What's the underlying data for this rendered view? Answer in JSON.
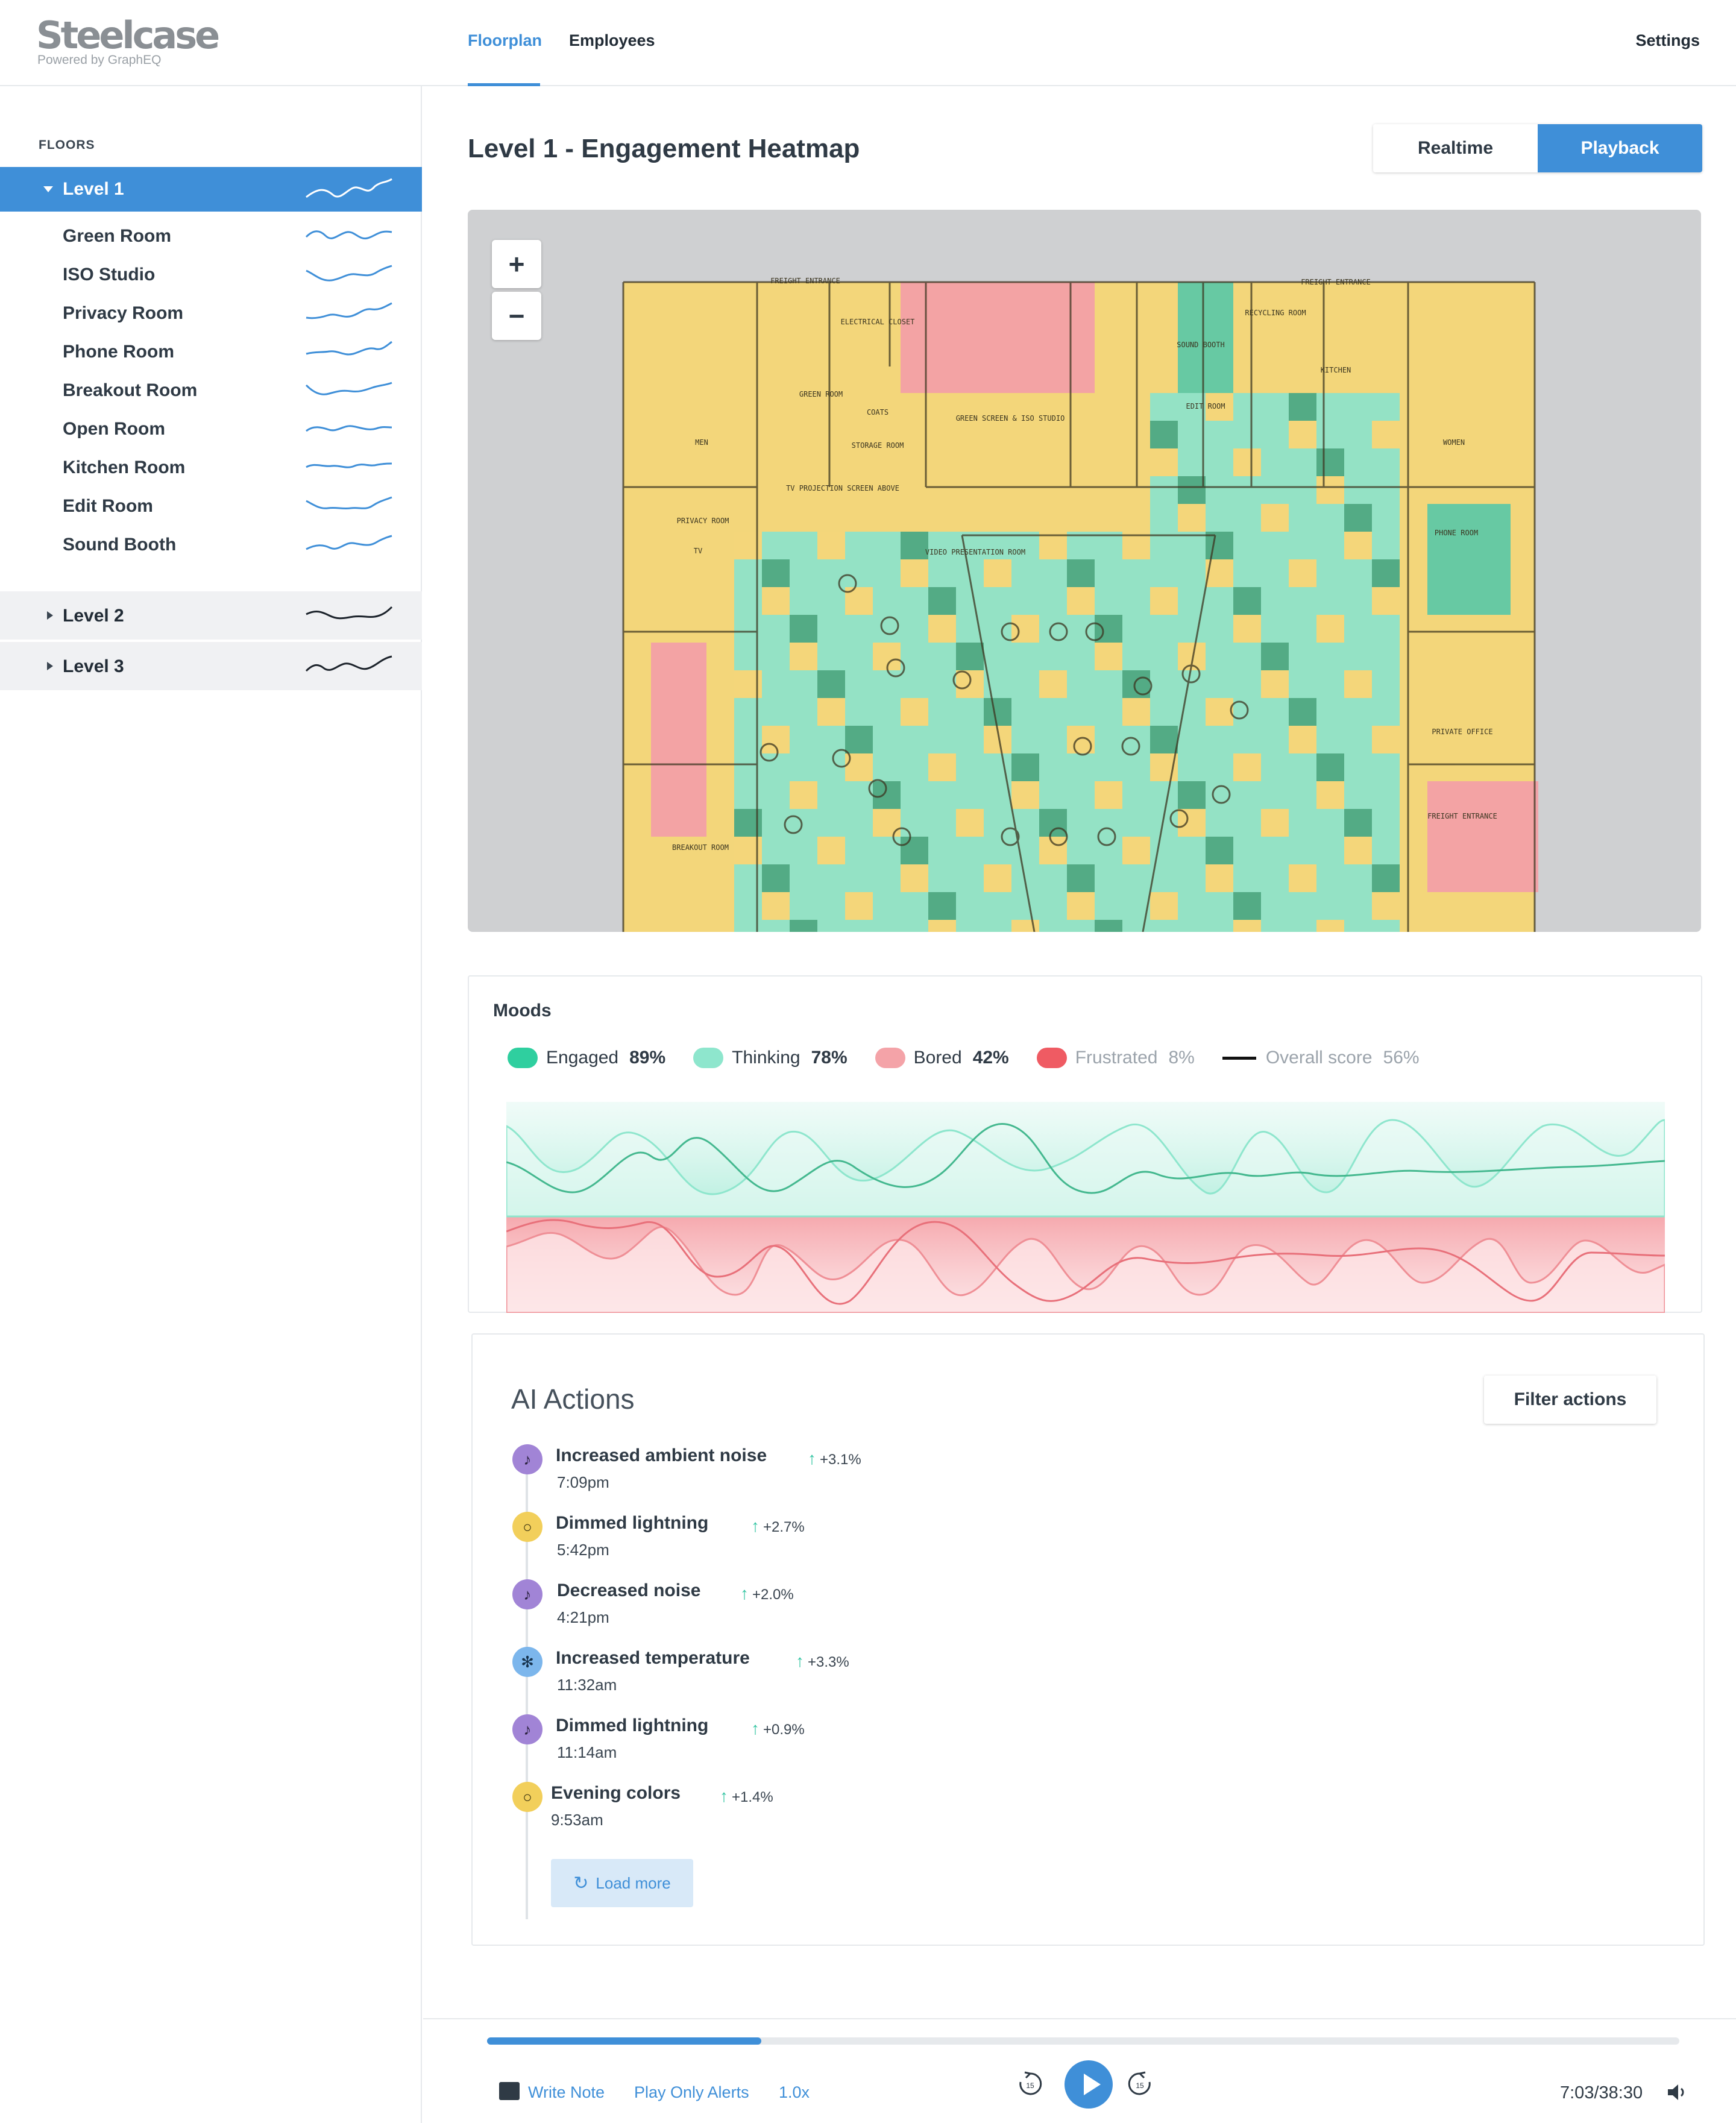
{
  "brand": {
    "name": "Steelcase",
    "sub": "Powered by GraphEQ"
  },
  "nav": {
    "tabs": [
      "Floorplan",
      "Employees"
    ],
    "active": "Floorplan",
    "settings": "Settings"
  },
  "sidebar": {
    "title": "FLOORS",
    "levels": [
      {
        "label": "Level 1",
        "expanded": true,
        "rooms": [
          "Green Room",
          "ISO Studio",
          "Privacy Room",
          "Phone Room",
          "Breakout Room",
          "Open Room",
          "Kitchen Room",
          "Edit Room",
          "Sound Booth"
        ]
      },
      {
        "label": "Level 2",
        "expanded": false
      },
      {
        "label": "Level 3",
        "expanded": false
      }
    ]
  },
  "main": {
    "title": "Level 1 - Engagement Heatmap",
    "mode": {
      "options": [
        "Realtime",
        "Playback"
      ],
      "selected": "Playback"
    },
    "zoom": {
      "in": "+",
      "out": "−"
    }
  },
  "floorplan_labels": [
    "FREIGHT ENTRANCE",
    "ELECTRICAL CLOSET",
    "GREEN ROOM",
    "COATS",
    "STORAGE ROOM",
    "GREEN SCREEN & ISO STUDIO",
    "SOUND BOOTH",
    "RECYCLING ROOM",
    "EDIT ROOM",
    "KITCHEN",
    "MEN",
    "WOMEN",
    "PRIVACY ROOM",
    "PHONE ROOM",
    "TV",
    "TV PROJECTION SCREEN ABOVE",
    "VIDEO PRESENTATION ROOM",
    "BREAKOUT ROOM",
    "PRIVATE OFFICE",
    "FREIGHT ENTRANCE"
  ],
  "moods": {
    "title": "Moods",
    "legend": [
      {
        "name": "Engaged",
        "value": "89%",
        "color": "#2fcf9f",
        "dim": false
      },
      {
        "name": "Thinking",
        "value": "78%",
        "color": "#8ee6cd",
        "dim": false
      },
      {
        "name": "Bored",
        "value": "42%",
        "color": "#f4a3a8",
        "dim": false
      },
      {
        "name": "Frustrated",
        "value": "8%",
        "color": "#ef5b63",
        "dim": true
      },
      {
        "name": "Overall score",
        "value": "56%",
        "color": "#111111",
        "dim": true
      }
    ]
  },
  "ai_actions": {
    "title": "AI Actions",
    "filter_label": "Filter actions",
    "items": [
      {
        "title": "Increased ambient noise",
        "delta": "+3.1%",
        "time": "7:09pm",
        "icon": "music-note-icon"
      },
      {
        "title": "Dimmed lightning",
        "delta": "+2.7%",
        "time": "5:42pm",
        "icon": "lightbulb-icon"
      },
      {
        "title": "Decreased noise",
        "delta": "+2.0%",
        "time": "4:21pm",
        "icon": "music-note-icon"
      },
      {
        "title": "Increased temperature",
        "delta": "+3.3%",
        "time": "11:32am",
        "icon": "snowflake-icon"
      },
      {
        "title": "Dimmed lightning",
        "delta": "+0.9%",
        "time": "11:14am",
        "icon": "music-note-icon"
      },
      {
        "title": "Evening colors",
        "delta": "+1.4%",
        "time": "9:53am",
        "icon": "lightbulb-icon"
      }
    ],
    "load_more": "Load more"
  },
  "playback": {
    "write_note": "Write Note",
    "play_only_alerts": "Play Only Alerts",
    "speed": "1.0x",
    "time": "7:03/38:30",
    "progress": 0.23,
    "skip_back": "15",
    "skip_forward": "15"
  },
  "colors": {
    "accent": "#3f8fd8",
    "engaged": "#2fcf9f",
    "thinking": "#8ee6cd",
    "bored": "#f4a3a8",
    "frustrated": "#ef5b63",
    "heat_neutral": "#f3d67a"
  }
}
